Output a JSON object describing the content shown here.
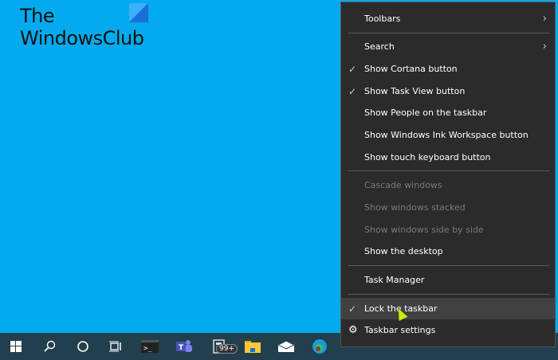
{
  "watermark": {
    "line1": "The",
    "line2": "WindowsClub"
  },
  "taskbar": {
    "icons": [
      "windows-start-icon",
      "search-icon",
      "cortana-icon",
      "task-view-icon",
      "terminal-icon",
      "teams-icon",
      "news-icon",
      "file-explorer-icon",
      "mail-icon",
      "edge-icon"
    ],
    "badge": "99+"
  },
  "menu": {
    "toolbars": "Toolbars",
    "search": "Search",
    "cortana": "Show Cortana button",
    "taskview": "Show Task View button",
    "people": "Show People on the taskbar",
    "ink": "Show Windows Ink Workspace button",
    "touch": "Show touch keyboard button",
    "cascade": "Cascade windows",
    "stacked": "Show windows stacked",
    "sidebyside": "Show windows side by side",
    "desktop": "Show the desktop",
    "taskmanager": "Task Manager",
    "lock": "Lock the taskbar",
    "settings": "Taskbar settings",
    "check": "✓",
    "chevron": "›",
    "gear": "⚙"
  }
}
